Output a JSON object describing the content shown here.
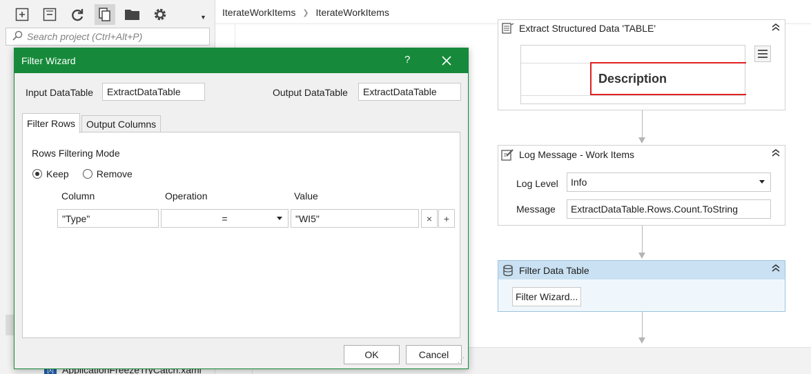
{
  "project_pane": {
    "search_placeholder": "Search project (Ctrl+Alt+P)",
    "toolbar_icons": [
      "expand-all-icon",
      "collapse-all-icon",
      "refresh-icon",
      "copy-files-icon",
      "open-folder-icon",
      "gear-icon"
    ],
    "file_item": "ApplicationFreezeTryCatch.xaml"
  },
  "designer": {
    "breadcrumb": [
      "IterateWorkItems",
      "IterateWorkItems"
    ],
    "extract_activity": {
      "title": "Extract Structured Data 'TABLE'",
      "preview_header": "Description"
    },
    "log_activity": {
      "title": "Log Message - Work Items",
      "log_level_label": "Log Level",
      "log_level_value": "Info",
      "message_label": "Message",
      "message_value": "ExtractDataTable.Rows.Count.ToString"
    },
    "filter_activity": {
      "title": "Filter Data Table",
      "button_label": "Filter Wizard..."
    }
  },
  "dialog": {
    "title": "Filter Wizard",
    "help": "?",
    "input_label": "Input DataTable",
    "input_value": "ExtractDataTable",
    "output_label": "Output DataTable",
    "output_value": "ExtractDataTable",
    "tabs": [
      "Filter Rows",
      "Output Columns"
    ],
    "mode_label": "Rows Filtering Mode",
    "mode_options": [
      "Keep",
      "Remove"
    ],
    "mode_selected": "Keep",
    "columns": [
      "Column",
      "Operation",
      "Value"
    ],
    "row": {
      "column": "\"Type\"",
      "operation": "=",
      "value": "\"WI5\""
    },
    "remove_row": "×",
    "add_row": "+",
    "ok_label": "OK",
    "cancel_label": "Cancel"
  },
  "colors": {
    "dialog_titlebar": "#168a3a",
    "selected_activity_header": "#c9e1f2",
    "highlight_border": "#e02020"
  }
}
